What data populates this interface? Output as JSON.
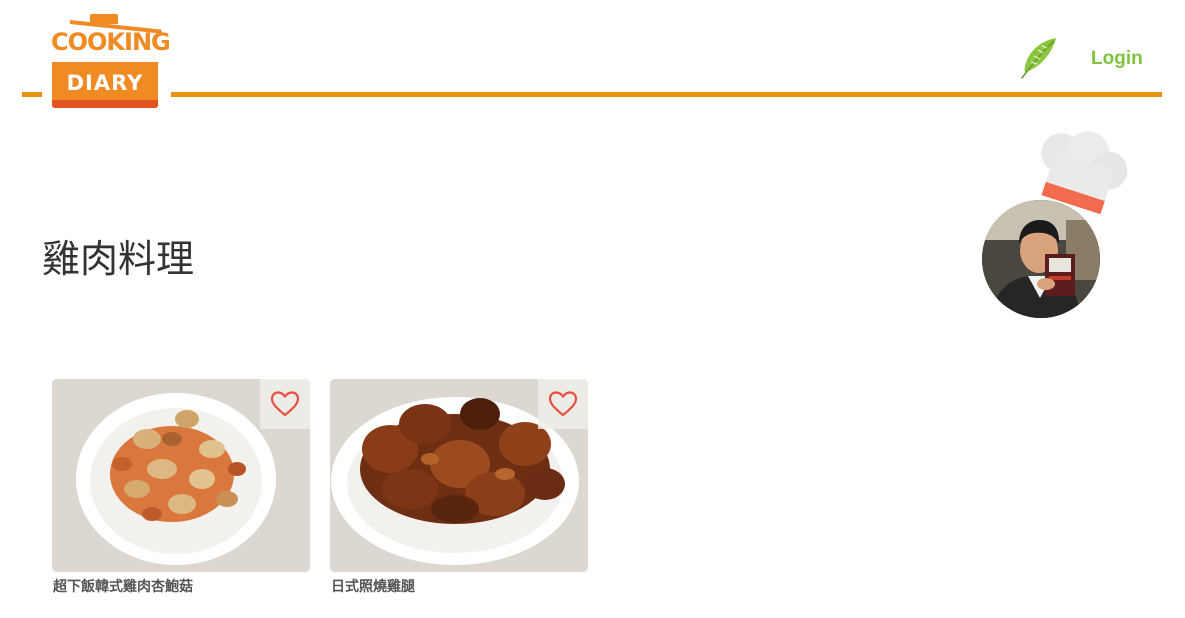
{
  "header": {
    "logo": {
      "line1": "COOKING",
      "line2": "DIARY"
    },
    "login_label": "Login",
    "icons": {
      "feather": "feather-icon"
    },
    "colors": {
      "accent": "#ea9313",
      "logo": "#f08a23",
      "login": "#7ec23d"
    }
  },
  "main": {
    "title": "雞肉料理",
    "author_avatar": "chef-avatar"
  },
  "recipes": [
    {
      "title": "超下飯韓式雞肉杏鮑菇",
      "favorite_icon": "heart-icon"
    },
    {
      "title": "日式照燒雞腿",
      "favorite_icon": "heart-icon"
    }
  ]
}
